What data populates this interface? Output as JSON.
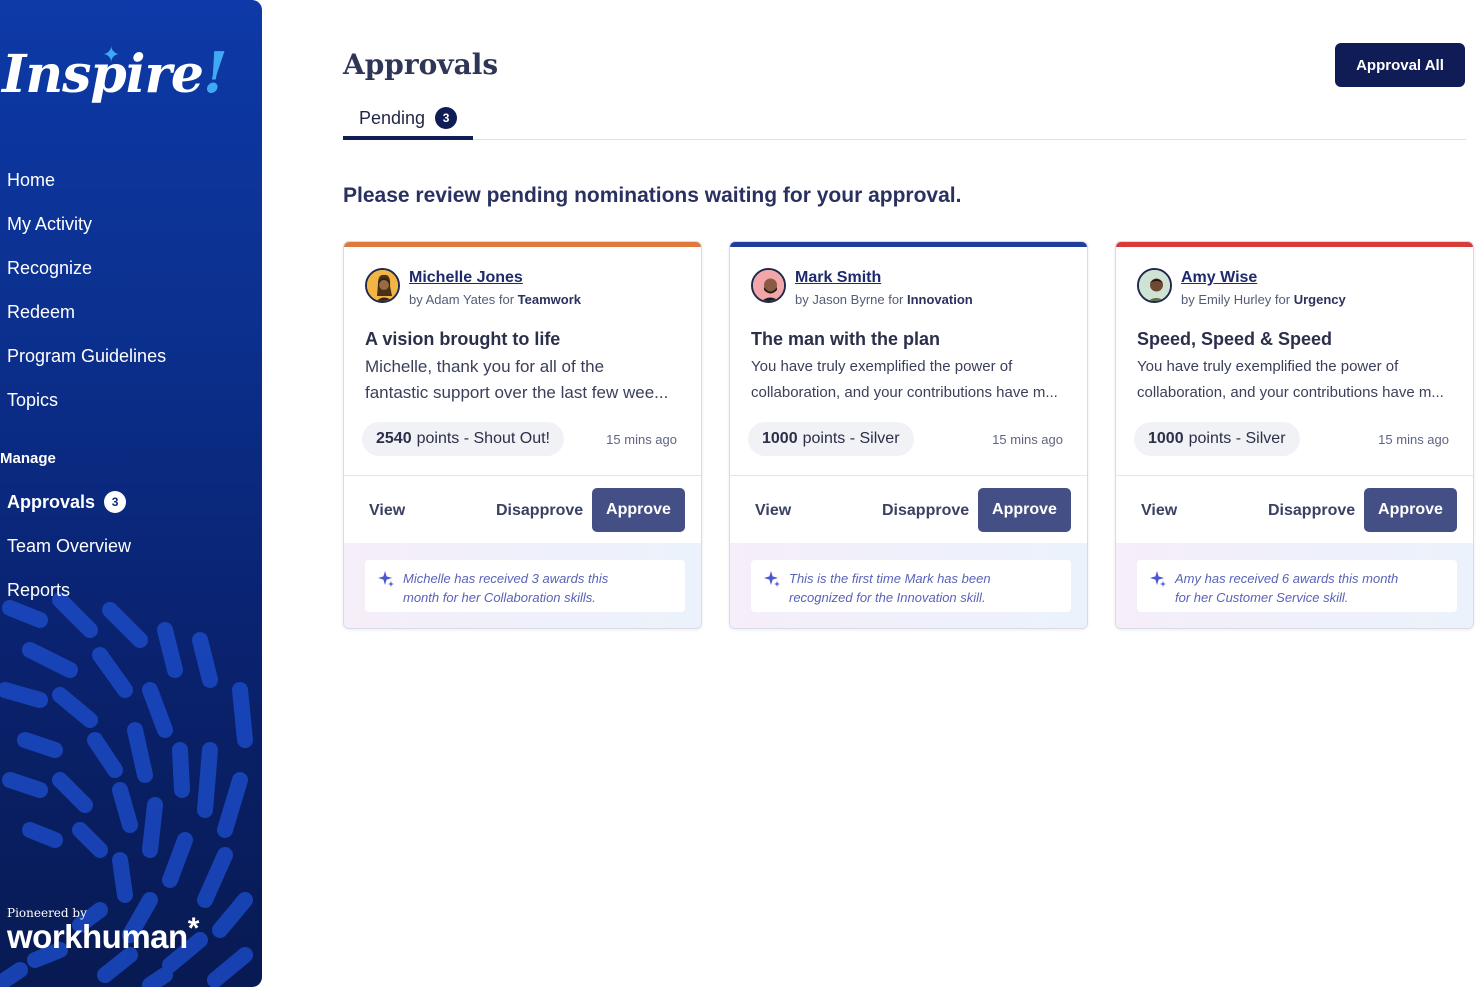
{
  "brand": {
    "logo_text": "Inspire",
    "logo_mark": "!",
    "pioneered_by": "Pioneered by",
    "partner": "workhuman",
    "partner_mark": "*"
  },
  "nav": {
    "items": [
      {
        "label": "Home"
      },
      {
        "label": "My Activity"
      },
      {
        "label": "Recognize"
      },
      {
        "label": "Redeem"
      },
      {
        "label": "Program Guidelines"
      },
      {
        "label": "Topics"
      }
    ],
    "manage_heading": "Manage",
    "manage_items": [
      {
        "label": "Approvals",
        "badge": "3"
      },
      {
        "label": "Team Overview"
      },
      {
        "label": "Reports"
      }
    ]
  },
  "header": {
    "title": "Approvals",
    "approve_all_label": "Approval All"
  },
  "tabs": [
    {
      "label": "Pending",
      "count": "3"
    }
  ],
  "subtitle": "Please review pending nominations waiting for your approval.",
  "colors": {
    "card1_accent": "#e07a3c",
    "card2_accent": "#1f3d9c",
    "card3_accent": "#d93b3b",
    "primary": "#0f1c55",
    "approve": "#444f86"
  },
  "cards": [
    {
      "name": "Michelle Jones",
      "by_prefix": "by Adam Yates for ",
      "category": "Teamwork",
      "title": "A vision brought to life",
      "body_line1": "Michelle, thank you for all of the",
      "body_line2": "fantastic support over the last few wee...",
      "points": "2540",
      "points_suffix": "points - Shout Out!",
      "time": "15 mins ago",
      "view": "View",
      "disapprove": "Disapprove",
      "approve": "Approve",
      "insight_line1": "Michelle has received 3 awards this",
      "insight_line2": "month for her Collaboration skills."
    },
    {
      "name": "Mark Smith",
      "by_prefix": "by Jason Byrne for ",
      "category": "Innovation",
      "title": "The man with the plan",
      "body_line1": "You have truly exemplified the power of",
      "body_line2": "collaboration, and your contributions have m...",
      "points": "1000",
      "points_suffix": "points - Silver",
      "time": "15 mins ago",
      "view": "View",
      "disapprove": "Disapprove",
      "approve": "Approve",
      "insight_line1": "This is the first time Mark has been",
      "insight_line2": "recognized for the Innovation skill."
    },
    {
      "name": "Amy Wise",
      "by_prefix": "by Emily Hurley for ",
      "category": "Urgency",
      "title": "Speed, Speed & Speed",
      "body_line1": "You have truly exemplified the power of",
      "body_line2": "collaboration, and your contributions have m...",
      "points": "1000",
      "points_suffix": "points - Silver",
      "time": "15 mins ago",
      "view": "View",
      "disapprove": "Disapprove",
      "approve": "Approve",
      "insight_line1": "Amy has received 6 awards this month",
      "insight_line2": "for her Customer Service skill."
    }
  ]
}
